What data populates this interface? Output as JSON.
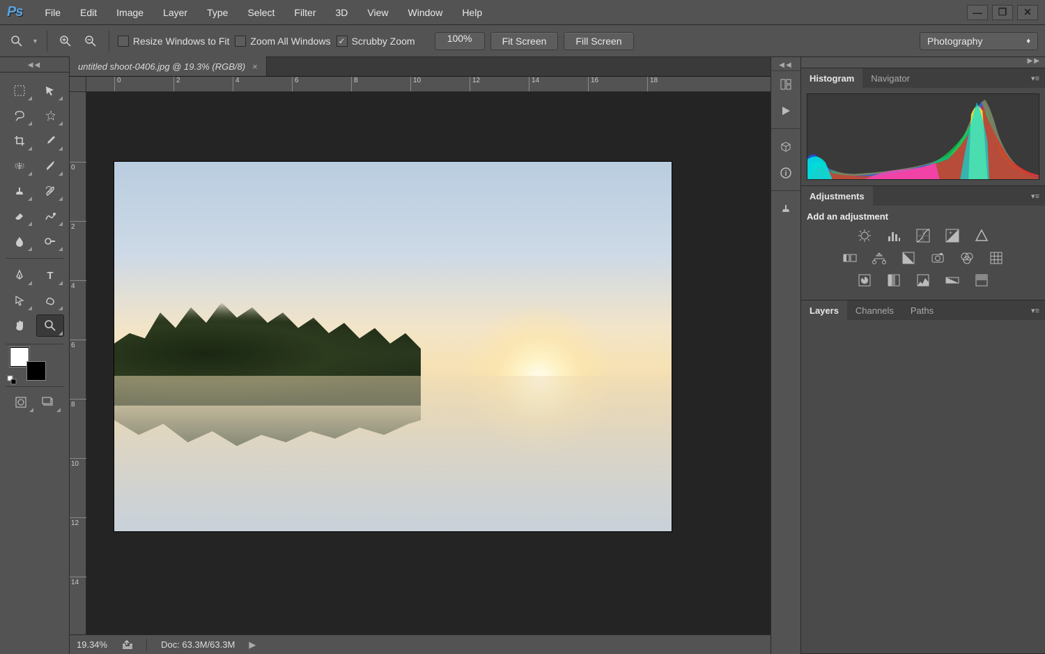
{
  "app": {
    "logo": "Ps"
  },
  "menu": [
    "File",
    "Edit",
    "Image",
    "Layer",
    "Type",
    "Select",
    "Filter",
    "3D",
    "View",
    "Window",
    "Help"
  ],
  "options": {
    "resize_windows": "Resize Windows to Fit",
    "zoom_all": "Zoom All Windows",
    "scrubby": "Scrubby Zoom",
    "zoom_value": "100%",
    "fit_screen": "Fit Screen",
    "fill_screen": "Fill Screen",
    "workspace": "Photography"
  },
  "document": {
    "tab_title": "untitled shoot-0406.jpg @ 19.3% (RGB/8)",
    "ruler_h": [
      "0",
      "2",
      "4",
      "6",
      "8",
      "10",
      "12",
      "14",
      "16",
      "18"
    ],
    "ruler_v": [
      "0",
      "2",
      "4",
      "6",
      "8",
      "10",
      "12",
      "14"
    ]
  },
  "status": {
    "zoom": "19.34%",
    "doc_size": "Doc: 63.3M/63.3M"
  },
  "panels": {
    "histogram_tabs": [
      "Histogram",
      "Navigator"
    ],
    "adjustments_tab": "Adjustments",
    "adjustments_label": "Add an adjustment",
    "layers_tabs": [
      "Layers",
      "Channels",
      "Paths"
    ]
  },
  "colors": {
    "foreground": "#ffffff",
    "background": "#000000"
  }
}
